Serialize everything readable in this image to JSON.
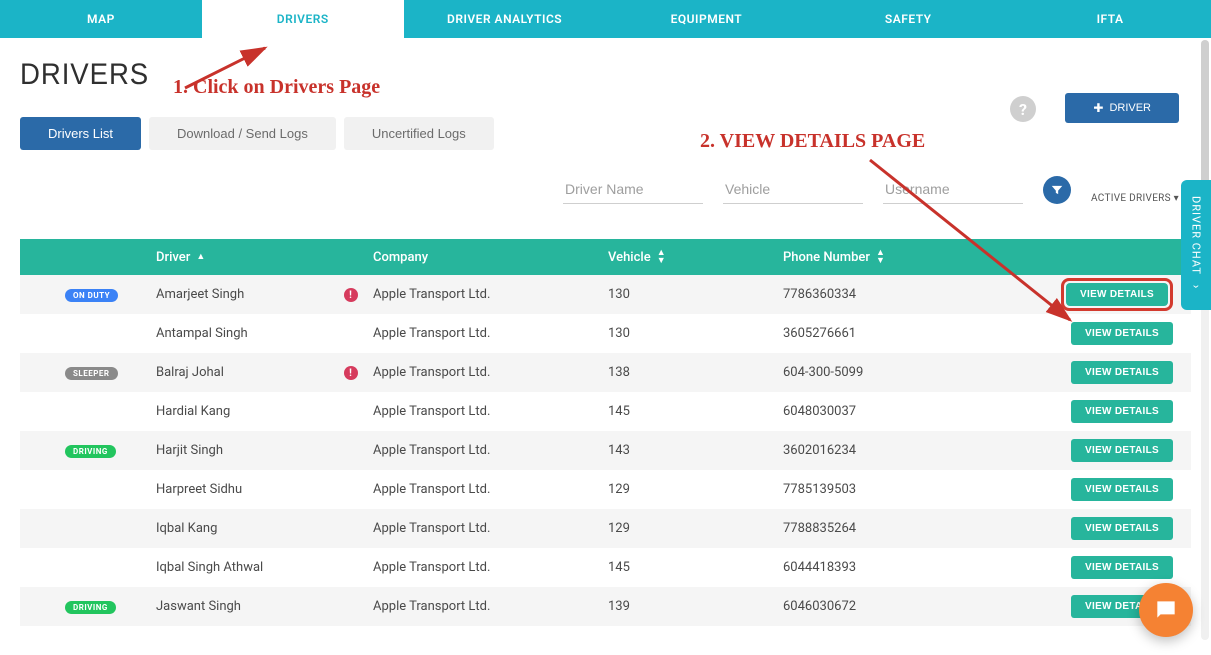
{
  "topnav": [
    {
      "label": "MAP",
      "active": false
    },
    {
      "label": "DRIVERS",
      "active": true
    },
    {
      "label": "DRIVER ANALYTICS",
      "active": false
    },
    {
      "label": "EQUIPMENT",
      "active": false
    },
    {
      "label": "SAFETY",
      "active": false
    },
    {
      "label": "IFTA",
      "active": false
    }
  ],
  "page_title": "DRIVERS",
  "help_symbol": "?",
  "add_driver_btn": "DRIVER",
  "subtabs": [
    {
      "label": "Drivers List",
      "active": true
    },
    {
      "label": "Download / Send Logs",
      "active": false
    },
    {
      "label": "Uncertified Logs",
      "active": false
    }
  ],
  "filters": {
    "driver_name_placeholder": "Driver Name",
    "vehicle_placeholder": "Vehicle",
    "username_placeholder": "Username",
    "active_drivers_label": "ACTIVE DRIVERS"
  },
  "columns": {
    "driver": "Driver",
    "company": "Company",
    "vehicle": "Vehicle",
    "phone": "Phone Number"
  },
  "view_details_label": "VIEW DETAILS",
  "rows": [
    {
      "status": "ON DUTY",
      "status_class": "onduty",
      "alert": true,
      "driver": "Amarjeet Singh",
      "company": "Apple Transport Ltd.",
      "vehicle": "130",
      "phone": "7786360334",
      "highlight": true
    },
    {
      "status": "",
      "status_class": "",
      "alert": false,
      "driver": "Antampal Singh",
      "company": "Apple Transport Ltd.",
      "vehicle": "130",
      "phone": "3605276661",
      "highlight": false
    },
    {
      "status": "SLEEPER",
      "status_class": "sleeper",
      "alert": true,
      "driver": "Balraj Johal",
      "company": "Apple Transport Ltd.",
      "vehicle": "138",
      "phone": "604-300-5099",
      "highlight": false
    },
    {
      "status": "",
      "status_class": "",
      "alert": false,
      "driver": "Hardial Kang",
      "company": "Apple Transport Ltd.",
      "vehicle": "145",
      "phone": "6048030037",
      "highlight": false
    },
    {
      "status": "DRIVING",
      "status_class": "driving",
      "alert": false,
      "driver": "Harjit Singh",
      "company": "Apple Transport Ltd.",
      "vehicle": "143",
      "phone": "3602016234",
      "highlight": false
    },
    {
      "status": "",
      "status_class": "",
      "alert": false,
      "driver": "Harpreet Sidhu",
      "company": "Apple Transport Ltd.",
      "vehicle": "129",
      "phone": "7785139503",
      "highlight": false
    },
    {
      "status": "",
      "status_class": "",
      "alert": false,
      "driver": "Iqbal Kang",
      "company": "Apple Transport Ltd.",
      "vehicle": "129",
      "phone": "7788835264",
      "highlight": false
    },
    {
      "status": "",
      "status_class": "",
      "alert": false,
      "driver": "Iqbal Singh Athwal",
      "company": "Apple Transport Ltd.",
      "vehicle": "145",
      "phone": "6044418393",
      "highlight": false
    },
    {
      "status": "DRIVING",
      "status_class": "driving",
      "alert": false,
      "driver": "Jaswant Singh",
      "company": "Apple Transport Ltd.",
      "vehicle": "139",
      "phone": "6046030672",
      "highlight": false
    }
  ],
  "annotations": {
    "a1": "1. Click on Drivers Page",
    "a2": "2. VIEW DETAILS PAGE"
  },
  "driver_chat_label": "DRIVER CHAT"
}
